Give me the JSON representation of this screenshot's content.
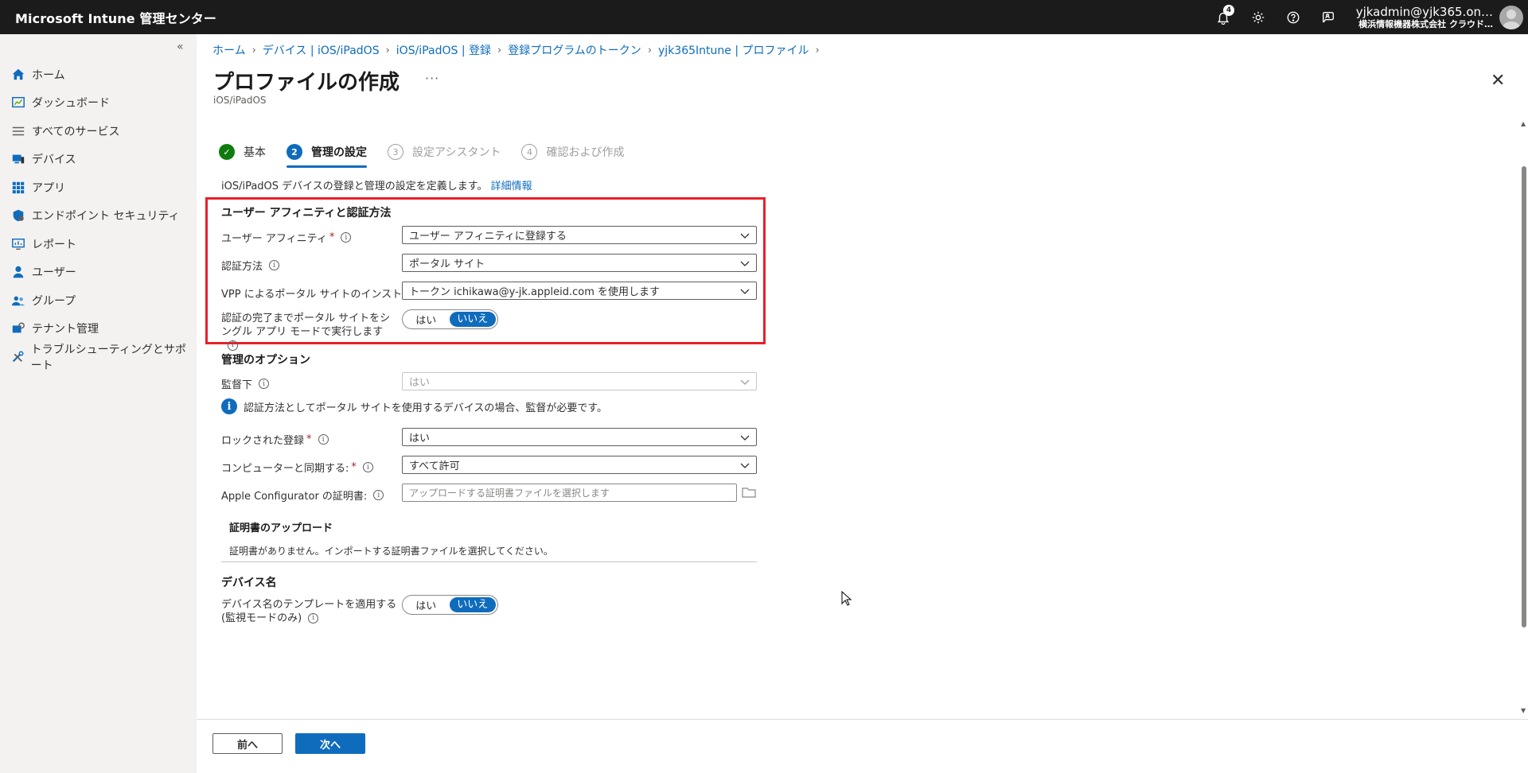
{
  "app": {
    "title": "Microsoft Intune 管理センター"
  },
  "topbar": {
    "notification_count": "4",
    "account_name": "yjkadmin@yjk365.on…",
    "account_org": "横浜情報機器株式会社 クラウド…"
  },
  "sidebar": {
    "collapse_label": "«",
    "items": [
      {
        "label": "ホーム",
        "icon": "home-icon"
      },
      {
        "label": "ダッシュボード",
        "icon": "dashboard-icon"
      },
      {
        "label": "すべてのサービス",
        "icon": "list-icon"
      },
      {
        "label": "デバイス",
        "icon": "devices-icon"
      },
      {
        "label": "アプリ",
        "icon": "apps-icon"
      },
      {
        "label": "エンドポイント セキュリティ",
        "icon": "shield-icon"
      },
      {
        "label": "レポート",
        "icon": "report-icon"
      },
      {
        "label": "ユーザー",
        "icon": "user-icon"
      },
      {
        "label": "グループ",
        "icon": "group-icon"
      },
      {
        "label": "テナント管理",
        "icon": "tenant-icon"
      },
      {
        "label": "トラブルシューティングとサポート",
        "icon": "troubleshoot-icon"
      }
    ]
  },
  "breadcrumb": [
    "ホーム",
    "デバイス | iOS/iPadOS",
    "iOS/iPadOS | 登録",
    "登録プログラムのトークン",
    "yjk365Intune | プロファイル"
  ],
  "page": {
    "title": "プロファイルの作成",
    "ellipsis": "···",
    "subtitle": "iOS/iPadOS",
    "close": "✕"
  },
  "steps": [
    {
      "num": "✓",
      "label": "基本",
      "state": "done"
    },
    {
      "num": "2",
      "label": "管理の設定",
      "state": "active"
    },
    {
      "num": "3",
      "label": "設定アシスタント",
      "state": "pending"
    },
    {
      "num": "4",
      "label": "確認および作成",
      "state": "pending"
    }
  ],
  "description": {
    "text": "iOS/iPadOS デバイスの登録と管理の設定を定義します。",
    "link": "詳細情報"
  },
  "section_affinity": {
    "heading": "ユーザー アフィニティと認証方法",
    "user_affinity_label": "ユーザー アフィニティ",
    "user_affinity_value": "ユーザー アフィニティに登録する",
    "auth_method_label": "認証方法",
    "auth_method_value": "ポータル サイト",
    "vpp_label": "VPP によるポータル サイトのインストール",
    "vpp_value": "トークン ichikawa@y-jk.appleid.com を使用します",
    "single_app_label": "認証の完了までポータル サイトをシングル アプリ モードで実行します",
    "single_app_yes": "はい",
    "single_app_no": "いいえ"
  },
  "section_management": {
    "heading": "管理のオプション",
    "supervised_label": "監督下",
    "supervised_value": "はい",
    "info_text": "認証方法としてポータル サイトを使用するデバイスの場合、監督が必要です。",
    "locked_label": "ロックされた登録",
    "locked_value": "はい",
    "sync_label": "コンピューターと同期する:",
    "sync_value": "すべて許可",
    "configurator_label": "Apple Configurator の証明書:",
    "configurator_placeholder": "アップロードする証明書ファイルを選択します"
  },
  "upload": {
    "title": "証明書のアップロード",
    "text": "証明書がありません。インポートする証明書ファイルを選択してください。"
  },
  "section_device_name": {
    "heading": "デバイス名",
    "template_label": "デバイス名のテンプレートを適用する (監視モードのみ)",
    "template_yes": "はい",
    "template_no": "いいえ"
  },
  "footer": {
    "prev_label": "前へ",
    "next_label": "次へ"
  },
  "colors": {
    "accent": "#0f6cbd",
    "highlight_border": "#e8202a",
    "topbar": "#1b1b1b",
    "success": "#107c10"
  }
}
